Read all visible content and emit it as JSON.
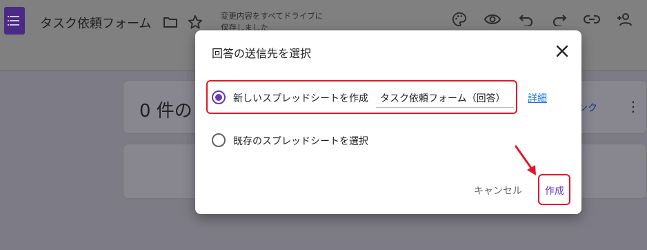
{
  "header": {
    "title": "タスク依頼フォーム",
    "save_status_line1": "変更内容をすべてドライブに",
    "save_status_line2": "保存しました",
    "icons": [
      "forms-logo-icon",
      "folder-icon",
      "star-icon",
      "palette-icon",
      "preview-eye-icon",
      "undo-icon",
      "redo-icon",
      "link-icon",
      "add-collaborator-icon"
    ]
  },
  "background": {
    "response_count": "0 件の",
    "link_text": "ンク",
    "more_icon": "more-vert-icon"
  },
  "dialog": {
    "title": "回答の送信先を選択",
    "close_icon": "close-icon",
    "options": [
      {
        "label": "新しいスプレッドシートを作成",
        "checked": true
      },
      {
        "label": "既存のスプレッドシートを選択",
        "checked": false
      }
    ],
    "spreadsheet_name": "タスク依頼フォーム（回答）",
    "learn_more": "詳細",
    "cancel": "キャンセル",
    "create": "作成"
  },
  "colors": {
    "accent": "#673ab7",
    "link": "#1a73e8",
    "annotation": "#e0182b"
  }
}
